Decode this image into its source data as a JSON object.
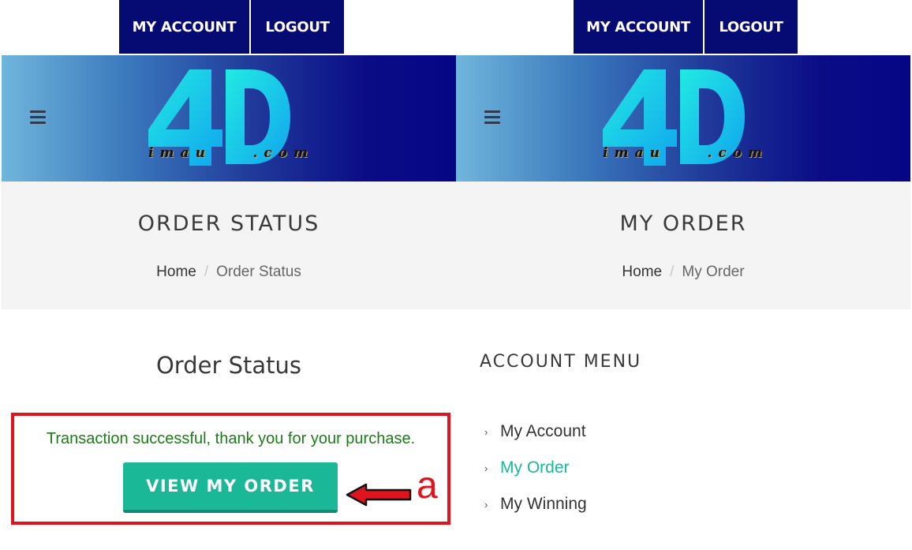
{
  "nav": {
    "account_label": "MY ACCOUNT",
    "logout_label": "LOGOUT"
  },
  "logo": {
    "main": "4D",
    "word_letters": [
      "i",
      "m",
      "a",
      "u",
      ".",
      "c",
      "o",
      "m"
    ]
  },
  "left": {
    "page_title": "ORDER STATUS",
    "breadcrumb": {
      "home": "Home",
      "separator": "/",
      "current": "Order Status"
    },
    "heading": "Order Status",
    "message": "Transaction successful, thank you for your purchase.",
    "button_label": "VIEW MY ORDER",
    "annotation": "a"
  },
  "right": {
    "page_title": "MY ORDER",
    "breadcrumb": {
      "home": "Home",
      "separator": "/",
      "current": "My Order"
    },
    "menu_heading": "ACCOUNT MENU",
    "menu_items": [
      "My Account",
      "My Order",
      "My Winning"
    ],
    "active_item": "My Order"
  },
  "colors": {
    "nav_bg": "#060a73",
    "accent": "#1bb898",
    "success": "#1b7d16",
    "highlight": "#e0141f"
  }
}
